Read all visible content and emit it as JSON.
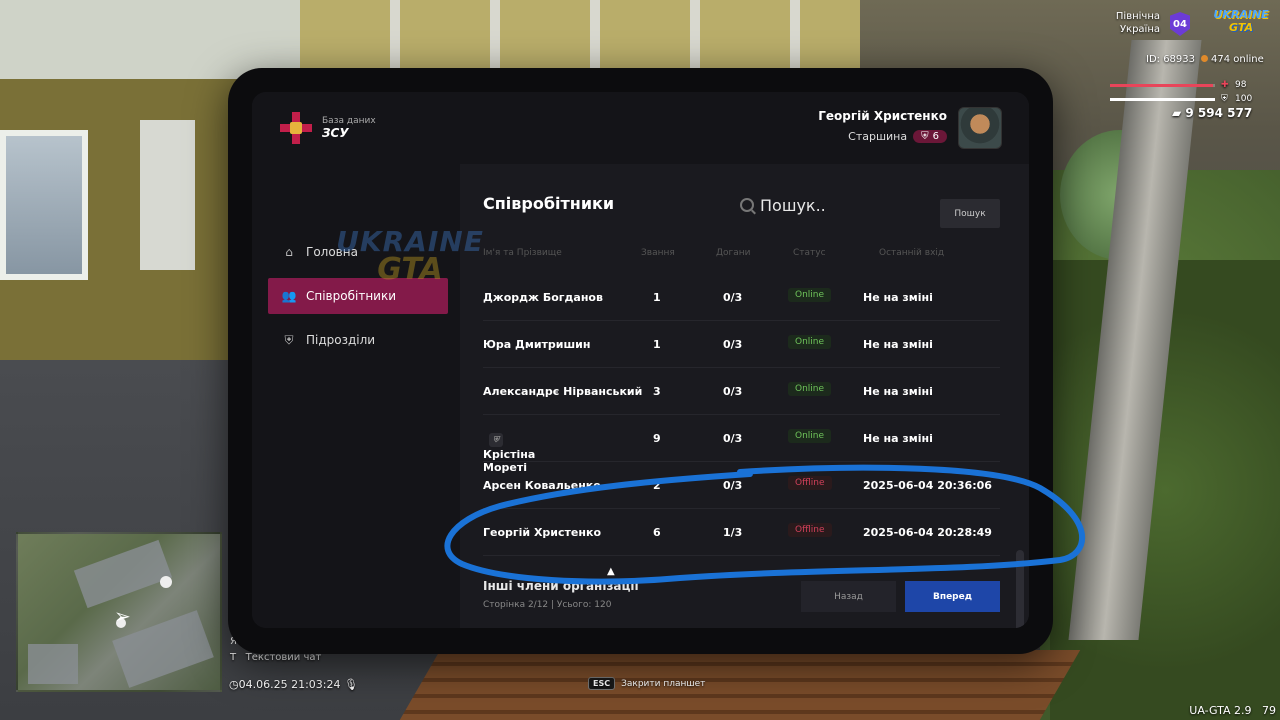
{
  "hud": {
    "region_line1": "Північна",
    "region_line2": "Україна",
    "region_badge": "04",
    "logo_line1": "UKRAINE",
    "logo_line2": "GTA",
    "player_id": "ID: 68933",
    "online": "474 online",
    "health": 98,
    "health_label": "98",
    "armor": 100,
    "armor_label": "100",
    "money": "9 594 577",
    "chat_line": "Текстовий чат",
    "chat_key": "T",
    "chat_key2": "Я",
    "datetime": "04.06.25 21:03:24",
    "esc_key": "ESC",
    "esc_label": "Закрити планшет",
    "version": "UA-GTA 2.9",
    "fps": "79",
    "colors": {
      "health": "#e8455a",
      "armor": "#ffffff",
      "accent": "#831a49",
      "primary_button": "#1e46a8"
    }
  },
  "tablet": {
    "brand_sub": "База даних",
    "brand_title": "ЗСУ",
    "user": {
      "name": "Георгій Христенко",
      "rank_title": "Старшина",
      "rank_level": "6"
    },
    "nav": [
      {
        "label": "Головна",
        "icon": "home-icon",
        "active": false
      },
      {
        "label": "Співробітники",
        "icon": "people-icon",
        "active": true
      },
      {
        "label": "Підрозділи",
        "icon": "shield-icon",
        "active": false
      }
    ],
    "page_title": "Співробітники",
    "search_placeholder": "Пошук..",
    "search_button": "Пошук",
    "columns": [
      "Ім'я та Прізвище",
      "Звання",
      "Догани",
      "Статус",
      "Останній вхід"
    ],
    "rows": [
      {
        "name": "Джордж Богданов",
        "rank": "1",
        "warnings": "0/3",
        "status": "Online",
        "last": "Не на зміні"
      },
      {
        "name": "Юра Дмитришин",
        "rank": "1",
        "warnings": "0/3",
        "status": "Online",
        "last": "Не на зміні"
      },
      {
        "name": "Александрє Нірванський",
        "rank": "3",
        "warnings": "0/3",
        "status": "Online",
        "last": "Не на зміні"
      },
      {
        "name": "Крістіна Мореті",
        "rank": "9",
        "warnings": "0/3",
        "status": "Online",
        "last": "Не на зміні"
      },
      {
        "name": "Арсен Ковальенко",
        "rank": "2",
        "warnings": "0/3",
        "status": "Offline",
        "last": "2025-06-04 20:36:06"
      },
      {
        "name": "Георгій Христенко",
        "rank": "6",
        "warnings": "1/3",
        "status": "Offline",
        "last": "2025-06-04 20:28:49"
      }
    ],
    "others_label": "Інші члени організації",
    "pager": "Сторінка 2/12 | Усього: 120",
    "back_button": "Назад",
    "next_button": "Вперед",
    "watermark_line1": "UKRAINE",
    "watermark_line2": "GTA"
  }
}
